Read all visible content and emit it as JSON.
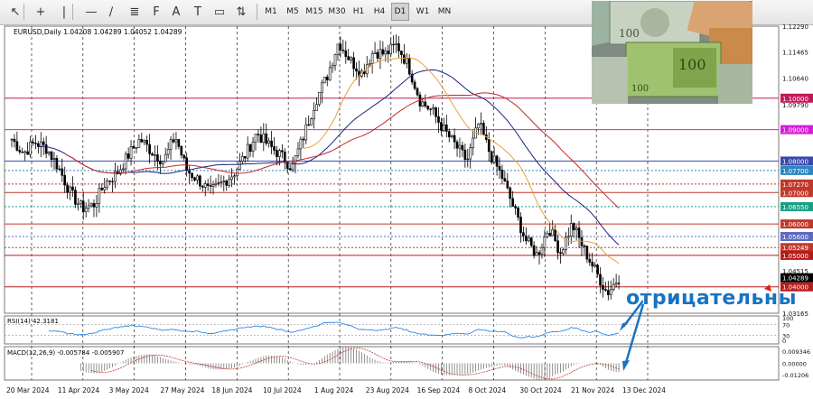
{
  "toolbar": {
    "timeframes": [
      "M1",
      "M5",
      "M15",
      "M30",
      "H1",
      "H4",
      "D1",
      "W1",
      "MN"
    ],
    "active_timeframe": "D1",
    "tools": [
      "cursor-icon",
      "crosshair-icon",
      "vertical-line-icon",
      "horizontal-line-icon",
      "trendline-icon",
      "channel-icon",
      "fibonacci-icon",
      "text-icon",
      "text-label-icon",
      "shapes-icon",
      "arrows-icon"
    ]
  },
  "colors": {
    "background": "#ffffff",
    "bull_candle": "#000000",
    "bear_candle": "#000000",
    "ma_fast": "#1a237e",
    "ma_mid": "#c62828",
    "ma_slow": "#e6a23c",
    "ma_orange": "#d35400",
    "rsi": "#2e86de",
    "macd_hist": "#777777",
    "macd_signal": "#c0392b",
    "annotation": "#1873c4"
  },
  "main_chart": {
    "header": "EURUSD,Daily  1.04208 1.04289 1.04052 1.04289",
    "current_price_label": "1.04289",
    "y_ticks": [
      "1.12290",
      "1.11465",
      "1.10640",
      "1.09790",
      "1.03165",
      "1.04515"
    ],
    "levels": [
      {
        "value": 1.1,
        "label": "1.10000",
        "color": "#c2185b",
        "style": "solid"
      },
      {
        "value": 1.09,
        "label": "1.09000",
        "color": "#d81bd8",
        "style": "solid"
      },
      {
        "value": 1.08,
        "label": "1.08000",
        "color": "#3949ab",
        "style": "solid"
      },
      {
        "value": 1.077,
        "label": "1.07700",
        "color": "#2e86c1",
        "style": "dotted"
      },
      {
        "value": 1.0727,
        "label": "1.07270",
        "color": "#c0392b",
        "style": "dotted"
      },
      {
        "value": 1.07,
        "label": "1.07000",
        "color": "#c0392b",
        "style": "solid"
      },
      {
        "value": 1.0655,
        "label": "1.06550",
        "color": "#16a085",
        "style": "dotted"
      },
      {
        "value": 1.06,
        "label": "1.06000",
        "color": "#c0392b",
        "style": "solid"
      },
      {
        "value": 1.056,
        "label": "1.05600",
        "color": "#5c6bc0",
        "style": "dotted"
      },
      {
        "value": 1.05249,
        "label": "1.05249",
        "color": "#c0392b",
        "style": "dotted"
      },
      {
        "value": 1.05,
        "label": "1.05000",
        "color": "#b71c1c",
        "style": "solid"
      },
      {
        "value": 1.04,
        "label": "1.04000",
        "color": "#b71c1c",
        "style": "solid"
      }
    ]
  },
  "x_labels": [
    "20 Mar 2024",
    "11 Apr 2024",
    "3 May 2024",
    "27 May 2024",
    "18 Jun 2024",
    "10 Jul 2024",
    "1 Aug 2024",
    "23 Aug 2024",
    "16 Sep 2024",
    "8 Oct 2024",
    "30 Oct 2024",
    "21 Nov 2024",
    "13 Dec 2024"
  ],
  "rsi": {
    "label": "RSI(14) 42.3181",
    "ticks": [
      "100",
      "70",
      "30",
      "0"
    ]
  },
  "macd": {
    "label": "MACD(12,26,9) -0.005784 -0.005907",
    "ticks": [
      "0.009346",
      "0.00000",
      "-0.01206"
    ]
  },
  "annotation_text": "отрицательны",
  "chart_data": {
    "type": "candlestick",
    "title": "EURUSD,Daily",
    "ylim": [
      1.0316,
      1.1229
    ],
    "x": [
      "20 Mar 2024",
      "11 Apr 2024",
      "3 May 2024",
      "27 May 2024",
      "18 Jun 2024",
      "10 Jul 2024",
      "1 Aug 2024",
      "23 Aug 2024",
      "16 Sep 2024",
      "8 Oct 2024",
      "30 Oct 2024",
      "21 Nov 2024",
      "13 Dec 2024"
    ],
    "close_path": [
      1.087,
      1.0825,
      1.086,
      1.084,
      1.078,
      1.07,
      1.065,
      1.066,
      1.073,
      1.076,
      1.082,
      1.087,
      1.083,
      1.08,
      1.088,
      1.077,
      1.074,
      1.07,
      1.073,
      1.076,
      1.082,
      1.089,
      1.085,
      1.082,
      1.078,
      1.088,
      1.099,
      1.107,
      1.118,
      1.112,
      1.108,
      1.115,
      1.114,
      1.117,
      1.11,
      1.099,
      1.096,
      1.09,
      1.085,
      1.08,
      1.092,
      1.082,
      1.075,
      1.065,
      1.055,
      1.05,
      1.059,
      1.051,
      1.06,
      1.052,
      1.045,
      1.038,
      1.043
    ]
  }
}
